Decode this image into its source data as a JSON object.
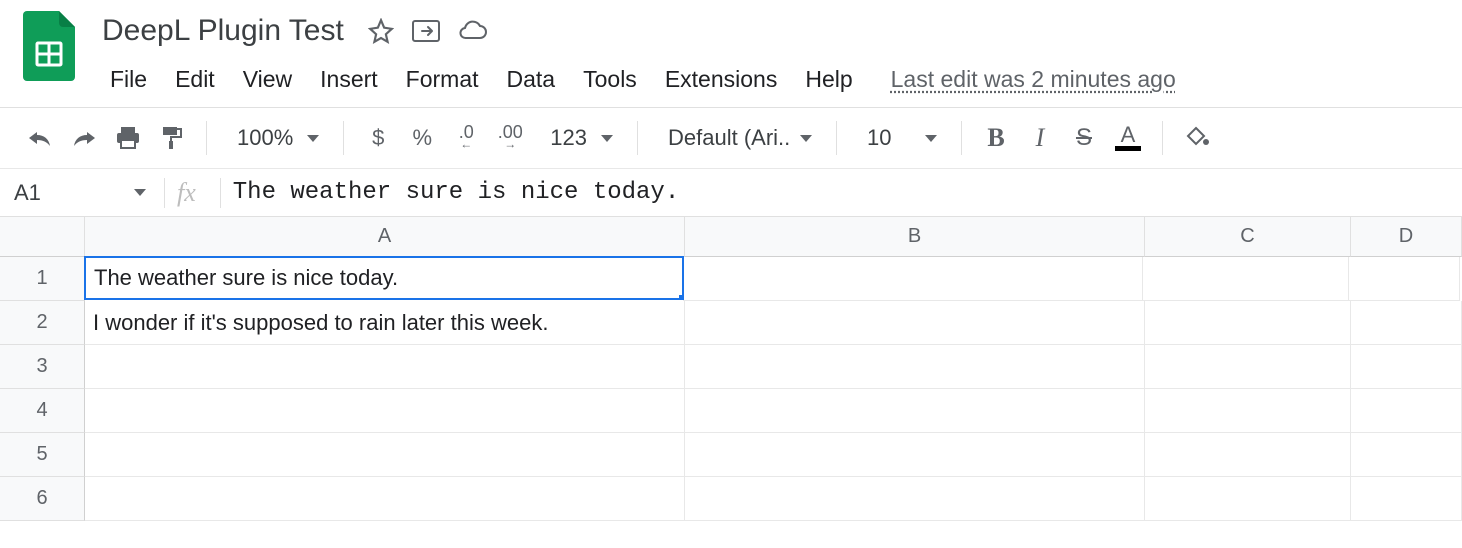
{
  "document": {
    "title": "DeepL Plugin Test",
    "last_edit": "Last edit was 2 minutes ago"
  },
  "menu": {
    "file": "File",
    "edit": "Edit",
    "view": "View",
    "insert": "Insert",
    "format": "Format",
    "data": "Data",
    "tools": "Tools",
    "extensions": "Extensions",
    "help": "Help"
  },
  "toolbar": {
    "zoom": "100%",
    "currency": "$",
    "percent": "%",
    "dec_decrease": ".0",
    "dec_increase": ".00",
    "more_formats": "123",
    "font": "Default (Ari...",
    "font_size": "10",
    "bold": "B",
    "italic": "I",
    "strike": "S",
    "textcolor": "A"
  },
  "formula": {
    "name_box": "A1",
    "fx": "fx",
    "value": "The weather sure is nice today."
  },
  "columns": [
    "A",
    "B",
    "C",
    "D"
  ],
  "rows": [
    "1",
    "2",
    "3",
    "4",
    "5",
    "6"
  ],
  "cells": {
    "A1": "The weather sure is nice today.",
    "A2": "I wonder if it's supposed to rain later this week."
  }
}
